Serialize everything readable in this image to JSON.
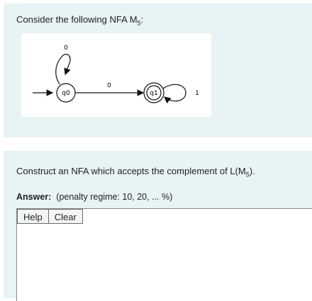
{
  "question1": {
    "text_prefix": "Consider the following NFA M",
    "subscript": "5",
    "text_suffix": ":"
  },
  "nfa": {
    "states": [
      "q0",
      "q1"
    ],
    "labels": {
      "loop_q0": "0",
      "edge": "0",
      "loop_q1": "1"
    }
  },
  "question2": {
    "text_prefix": "Construct an NFA which accepts the complement of L(M",
    "subscript": "5",
    "text_suffix": ")."
  },
  "answer": {
    "label": "Answer:",
    "penalty": "(penalty regime: 10, 20, ... %)"
  },
  "buttons": {
    "help": "Help",
    "clear": "Clear"
  }
}
